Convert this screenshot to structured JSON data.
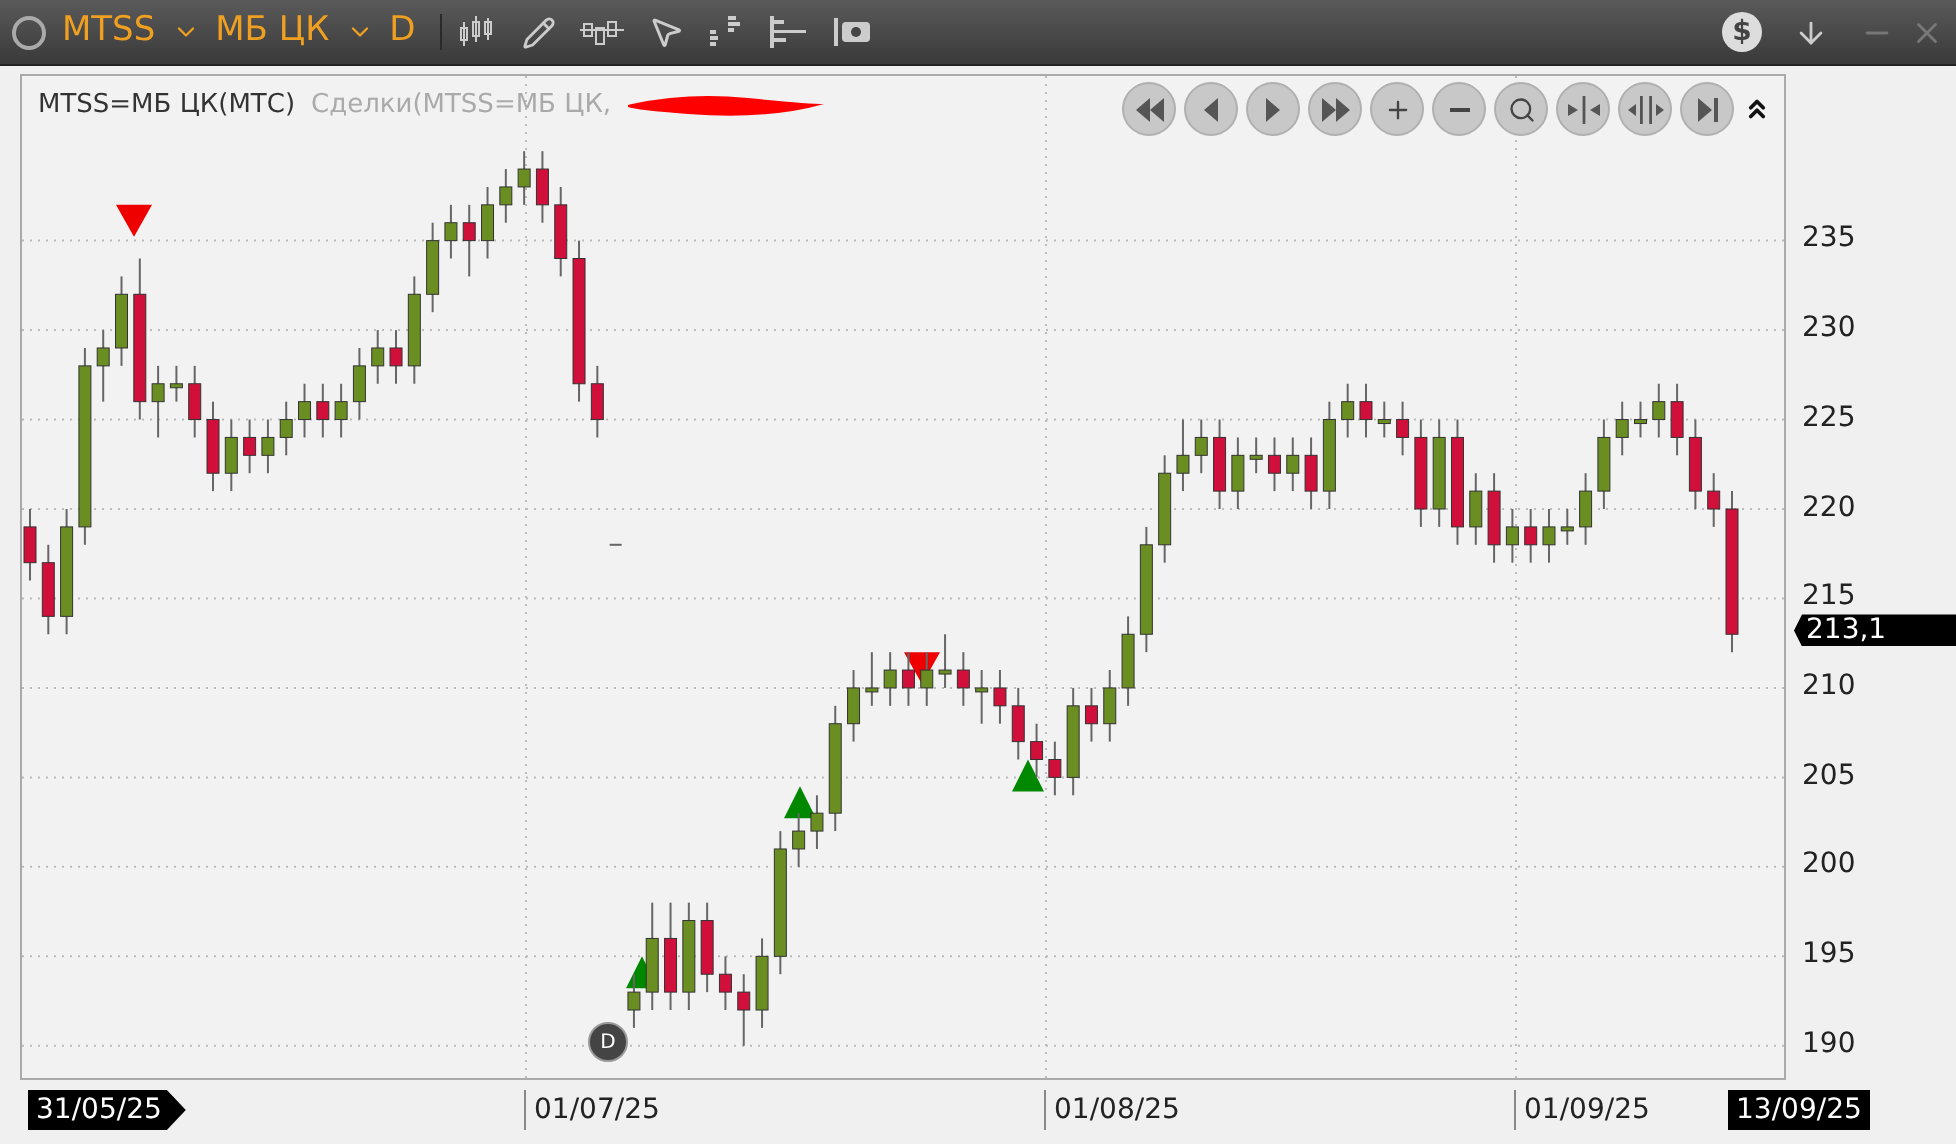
{
  "toolbar": {
    "symbol": "MTSS",
    "exchange": "МБ ЦК",
    "interval": "D",
    "currency_symbol": "$"
  },
  "legend": {
    "instrument": "MTSS=МБ ЦК(МТС)",
    "series": "Сделки(MTSS=МБ ЦК,"
  },
  "chart_data": {
    "type": "candlestick",
    "ohlc": [
      [
        219,
        220,
        216,
        217
      ],
      [
        217,
        218,
        213,
        214
      ],
      [
        214,
        220,
        213,
        219
      ],
      [
        219,
        229,
        218,
        228
      ],
      [
        228,
        230,
        226,
        229
      ],
      [
        229,
        233,
        228,
        232
      ],
      [
        232,
        234,
        225,
        226
      ],
      [
        226,
        228,
        224,
        227
      ],
      [
        227,
        228,
        226,
        227
      ],
      [
        227,
        228,
        224,
        225
      ],
      [
        225,
        226,
        221,
        222
      ],
      [
        222,
        225,
        221,
        224
      ],
      [
        224,
        225,
        222,
        223
      ],
      [
        223,
        225,
        222,
        224
      ],
      [
        224,
        226,
        223,
        225
      ],
      [
        225,
        227,
        224,
        226
      ],
      [
        226,
        227,
        224,
        225
      ],
      [
        225,
        227,
        224,
        226
      ],
      [
        226,
        229,
        225,
        228
      ],
      [
        228,
        230,
        227,
        229
      ],
      [
        229,
        230,
        227,
        228
      ],
      [
        228,
        233,
        227,
        232
      ],
      [
        232,
        236,
        231,
        235
      ],
      [
        235,
        237,
        234,
        236
      ],
      [
        236,
        237,
        233,
        235
      ],
      [
        235,
        238,
        234,
        237
      ],
      [
        237,
        239,
        236,
        238
      ],
      [
        238,
        240,
        237,
        239
      ],
      [
        239,
        240,
        236,
        237
      ],
      [
        237,
        238,
        233,
        234
      ],
      [
        234,
        235,
        226,
        227
      ],
      [
        227,
        228,
        224,
        225
      ],
      [
        218,
        218,
        218,
        218
      ],
      [
        192,
        194,
        191,
        193
      ],
      [
        193,
        198,
        192,
        196
      ],
      [
        196,
        198,
        192,
        193
      ],
      [
        193,
        198,
        192,
        197
      ],
      [
        197,
        198,
        193,
        194
      ],
      [
        194,
        195,
        192,
        193
      ],
      [
        193,
        194,
        190,
        192
      ],
      [
        192,
        196,
        191,
        195
      ],
      [
        195,
        202,
        194,
        201
      ],
      [
        201,
        203,
        200,
        202
      ],
      [
        202,
        204,
        201,
        203
      ],
      [
        203,
        209,
        202,
        208
      ],
      [
        208,
        211,
        207,
        210
      ],
      [
        210,
        212,
        209,
        210
      ],
      [
        210,
        212,
        209,
        211
      ],
      [
        211,
        212,
        209,
        210
      ],
      [
        210,
        212,
        209,
        211
      ],
      [
        211,
        213,
        210,
        211
      ],
      [
        211,
        212,
        209,
        210
      ],
      [
        210,
        211,
        208,
        210
      ],
      [
        210,
        211,
        208,
        209
      ],
      [
        209,
        210,
        206,
        207
      ],
      [
        207,
        208,
        205,
        206
      ],
      [
        206,
        207,
        204,
        205
      ],
      [
        205,
        210,
        204,
        209
      ],
      [
        209,
        210,
        207,
        208
      ],
      [
        208,
        211,
        207,
        210
      ],
      [
        210,
        214,
        209,
        213
      ],
      [
        213,
        219,
        212,
        218
      ],
      [
        218,
        223,
        217,
        222
      ],
      [
        222,
        225,
        221,
        223
      ],
      [
        223,
        225,
        222,
        224
      ],
      [
        224,
        225,
        220,
        221
      ],
      [
        221,
        224,
        220,
        223
      ],
      [
        223,
        224,
        222,
        223
      ],
      [
        223,
        224,
        221,
        222
      ],
      [
        222,
        224,
        221,
        223
      ],
      [
        223,
        224,
        220,
        221
      ],
      [
        221,
        226,
        220,
        225
      ],
      [
        225,
        227,
        224,
        226
      ],
      [
        226,
        227,
        224,
        225
      ],
      [
        225,
        226,
        224,
        225
      ],
      [
        225,
        226,
        223,
        224
      ],
      [
        224,
        225,
        219,
        220
      ],
      [
        220,
        225,
        219,
        224
      ],
      [
        224,
        225,
        218,
        219
      ],
      [
        219,
        222,
        218,
        221
      ],
      [
        221,
        222,
        217,
        218
      ],
      [
        218,
        220,
        217,
        219
      ],
      [
        219,
        220,
        217,
        218
      ],
      [
        218,
        220,
        217,
        219
      ],
      [
        219,
        220,
        218,
        219
      ],
      [
        219,
        222,
        218,
        221
      ],
      [
        221,
        225,
        220,
        224
      ],
      [
        224,
        226,
        223,
        225
      ],
      [
        225,
        226,
        224,
        225
      ],
      [
        225,
        227,
        224,
        226
      ],
      [
        226,
        227,
        223,
        224
      ],
      [
        224,
        225,
        220,
        221
      ],
      [
        221,
        222,
        219,
        220
      ],
      [
        220,
        221,
        212,
        213
      ]
    ],
    "ylim": [
      188.2,
      244.2
    ],
    "yticks": [
      {
        "value": 235,
        "label": "235"
      },
      {
        "value": 230,
        "label": "230"
      },
      {
        "value": 225,
        "label": "225"
      },
      {
        "value": 220,
        "label": "220"
      },
      {
        "value": 215,
        "label": "215"
      },
      {
        "value": 210,
        "label": "210"
      },
      {
        "value": 205,
        "label": "205"
      },
      {
        "value": 200,
        "label": "200"
      },
      {
        "value": 195,
        "label": "195"
      },
      {
        "value": 190,
        "label": "190"
      }
    ],
    "categories": [
      null,
      null,
      null,
      null,
      null,
      null,
      null,
      null,
      null,
      null,
      null,
      null,
      null,
      null,
      null,
      null,
      null,
      null,
      null,
      null,
      null,
      null,
      null,
      null,
      null,
      null,
      null,
      null,
      null,
      null,
      null,
      null,
      null,
      null,
      null,
      null,
      null,
      null,
      null,
      null,
      null,
      null,
      null,
      null,
      null,
      null,
      null,
      null,
      null,
      null,
      null,
      null,
      null,
      null,
      null,
      null,
      null,
      null,
      null,
      null,
      null,
      null,
      null,
      null,
      null,
      null,
      null,
      null,
      null,
      null,
      null,
      null,
      null,
      null,
      null,
      null,
      null,
      null,
      null,
      null,
      null,
      null,
      null,
      null,
      null,
      null,
      null,
      null,
      null,
      null,
      null,
      null,
      null,
      null
    ],
    "grid": true
  },
  "price_marker": "213,1",
  "dividend_marker": "D",
  "x_axis": {
    "labels": [
      {
        "text": "31/05/25",
        "kind": "start"
      },
      {
        "text": "01/07/25",
        "kind": "tick"
      },
      {
        "text": "01/08/25",
        "kind": "tick"
      },
      {
        "text": "01/09/25",
        "kind": "tick"
      },
      {
        "text": "13/09/25",
        "kind": "end"
      }
    ]
  }
}
